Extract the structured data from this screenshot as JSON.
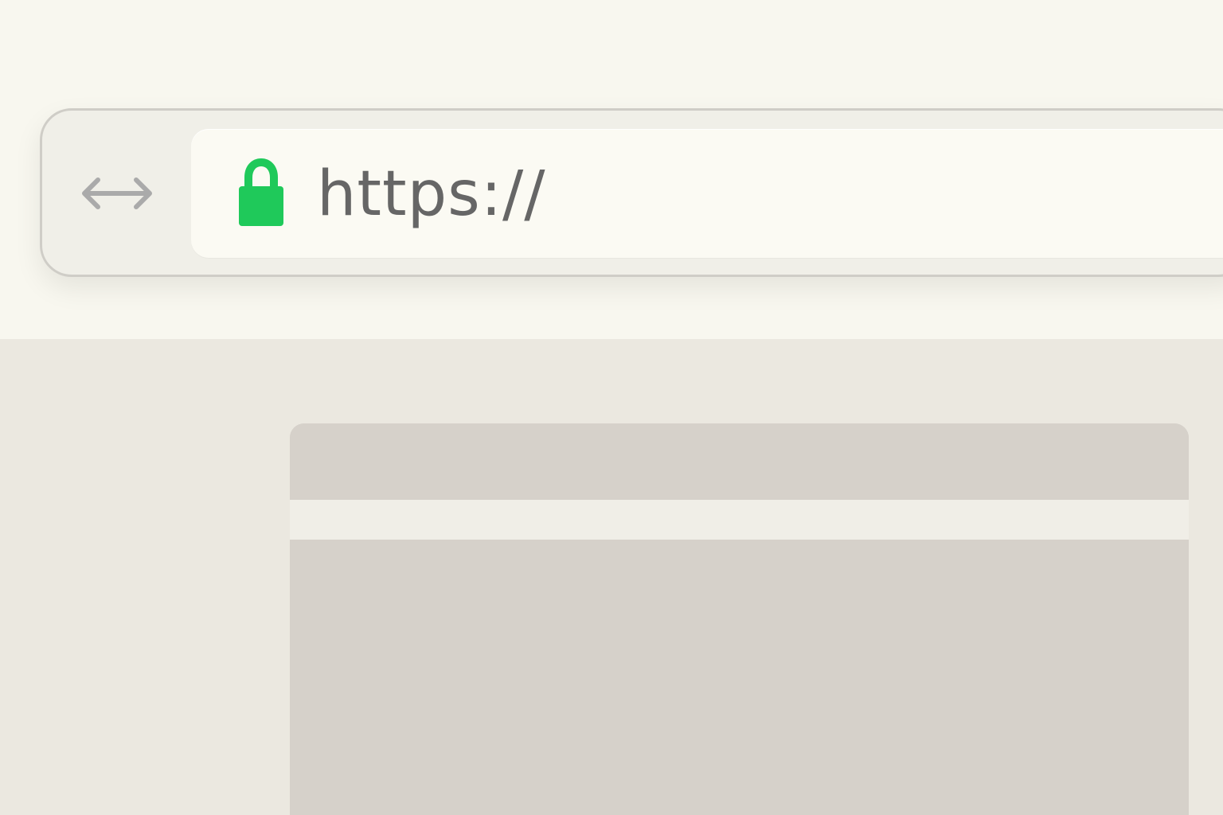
{
  "browser": {
    "address_bar": {
      "url": "https://",
      "secure": true,
      "lock_icon": "lock-icon",
      "lock_color": "#1fc95a"
    },
    "navigation": {
      "icon": "bidirectional-arrow-icon",
      "icon_color": "#aaaaaa"
    }
  },
  "page": {
    "colors": {
      "background_top": "#f8f7ef",
      "content_background": "#ebe8e0",
      "card_color": "#d6d1ca",
      "card_band_color": "#f0eee7"
    }
  }
}
